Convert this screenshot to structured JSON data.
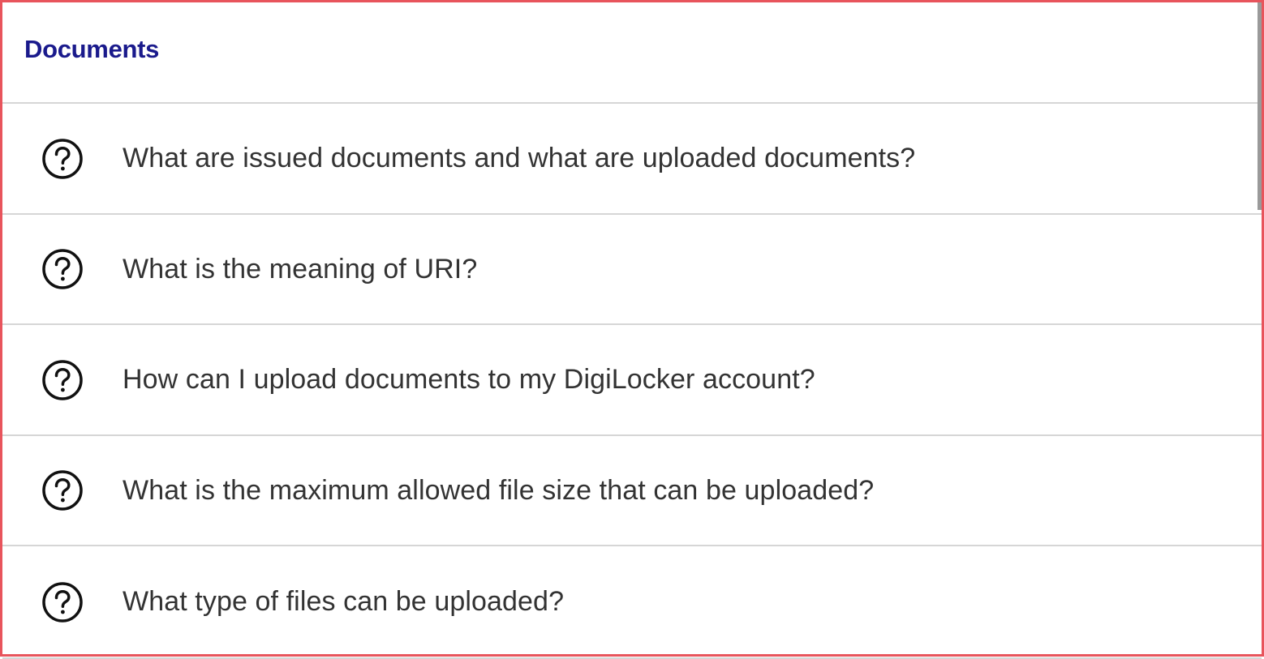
{
  "section": {
    "title": "Documents"
  },
  "faqs": [
    {
      "question": "What are issued documents and what are uploaded documents?",
      "icon": "question-circle-icon"
    },
    {
      "question": "What is the meaning of URI?",
      "icon": "question-circle-icon"
    },
    {
      "question": "How can I upload documents to my DigiLocker account?",
      "icon": "question-circle-icon"
    },
    {
      "question": "What is the maximum allowed file size that can be uploaded?",
      "icon": "question-circle-icon"
    },
    {
      "question": "What type of files can be uploaded?",
      "icon": "question-circle-icon"
    }
  ],
  "colors": {
    "title": "#1a1a8c",
    "text": "#333333",
    "divider": "#d6d6d6",
    "frame_border": "#e8545c"
  }
}
